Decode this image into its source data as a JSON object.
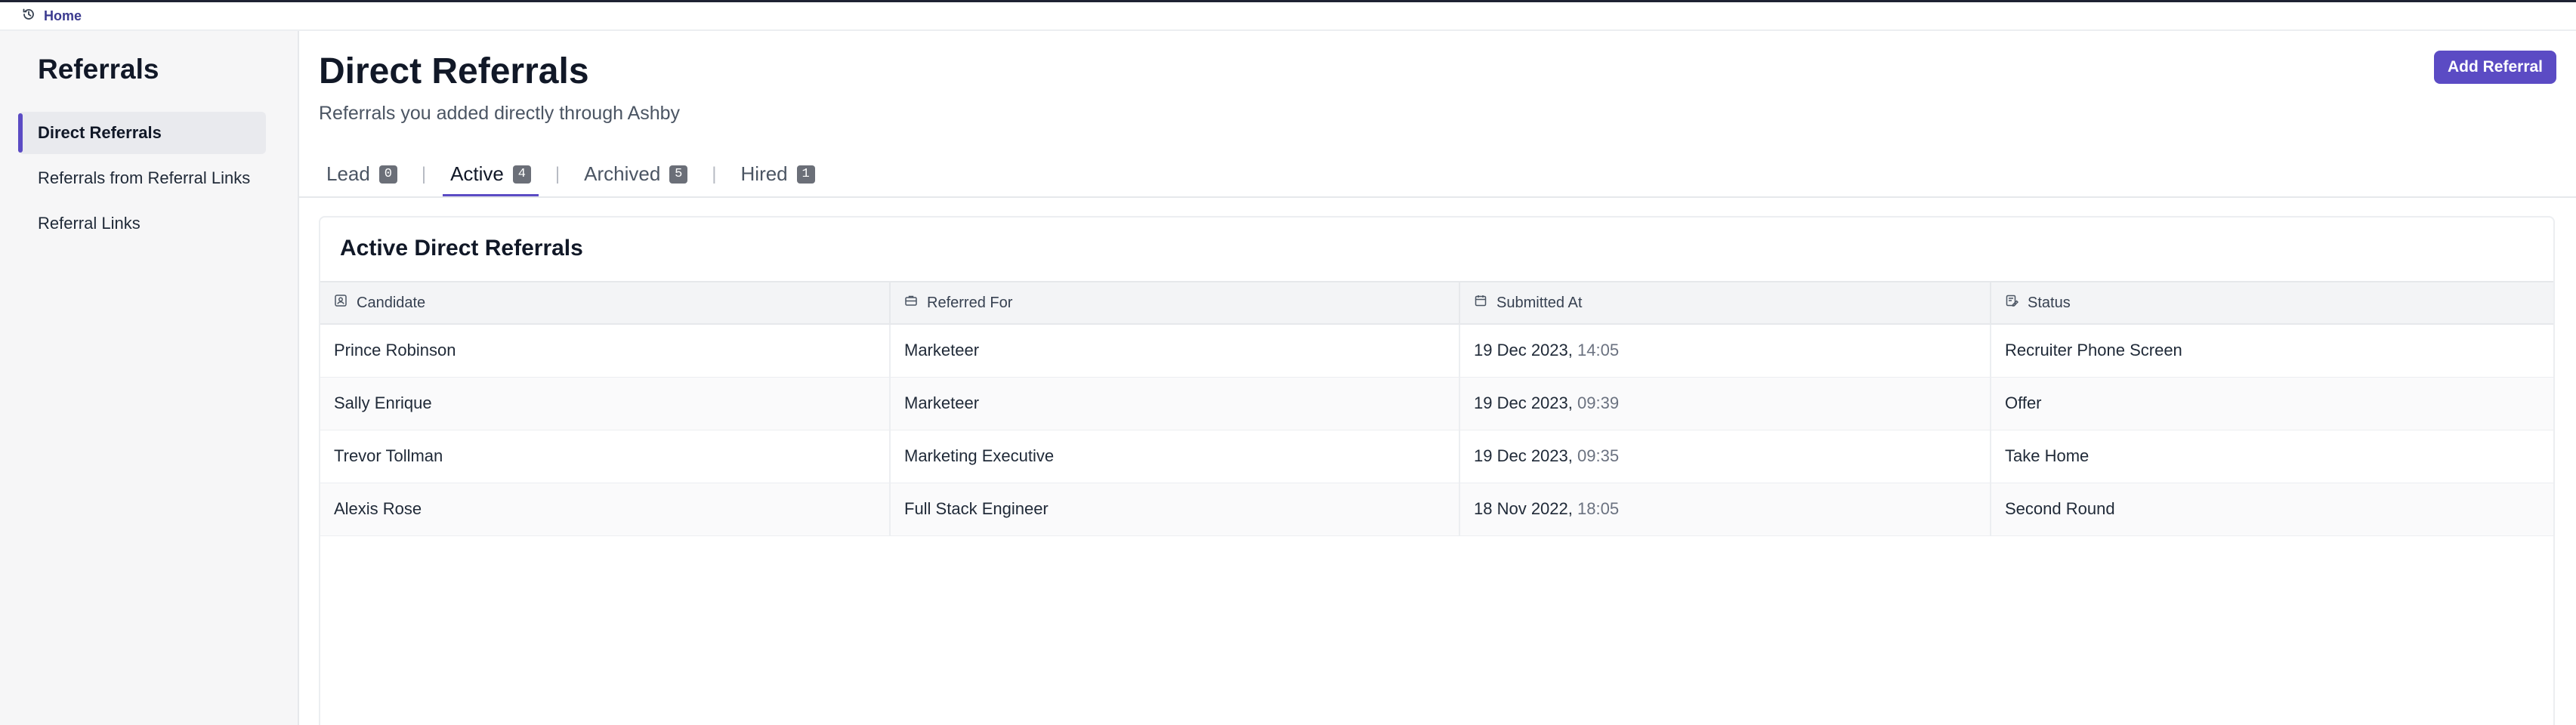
{
  "topbar": {
    "home_label": "Home"
  },
  "sidebar": {
    "title": "Referrals",
    "items": [
      {
        "label": "Direct Referrals",
        "active": true
      },
      {
        "label": "Referrals from Referral Links",
        "active": false
      },
      {
        "label": "Referral Links",
        "active": false
      }
    ]
  },
  "header": {
    "title": "Direct Referrals",
    "subtitle": "Referrals you added directly through Ashby",
    "add_button": "Add Referral"
  },
  "tabs": [
    {
      "label": "Lead",
      "count": "0",
      "active": false
    },
    {
      "label": "Active",
      "count": "4",
      "active": true
    },
    {
      "label": "Archived",
      "count": "5",
      "active": false
    },
    {
      "label": "Hired",
      "count": "1",
      "active": false
    }
  ],
  "table": {
    "title": "Active Direct Referrals",
    "columns": [
      {
        "label": "Candidate",
        "icon": "id-card-icon"
      },
      {
        "label": "Referred For",
        "icon": "briefcase-icon"
      },
      {
        "label": "Submitted At",
        "icon": "calendar-icon"
      },
      {
        "label": "Status",
        "icon": "status-edit-icon"
      }
    ],
    "rows": [
      {
        "candidate": "Prince Robinson",
        "referred_for": "Marketeer",
        "date": "19 Dec 2023,",
        "time": "14:05",
        "status": "Recruiter Phone Screen"
      },
      {
        "candidate": "Sally Enrique",
        "referred_for": "Marketeer",
        "date": "19 Dec 2023,",
        "time": "09:39",
        "status": "Offer"
      },
      {
        "candidate": "Trevor Tollman",
        "referred_for": "Marketing Executive",
        "date": "19 Dec 2023,",
        "time": "09:35",
        "status": "Take Home"
      },
      {
        "candidate": "Alexis Rose",
        "referred_for": "Full Stack Engineer",
        "date": "18 Nov 2022,",
        "time": "18:05",
        "status": "Second Round"
      }
    ]
  },
  "colors": {
    "accent": "#5b4bc4",
    "home_link": "#3b3a8f",
    "sidebar_bg": "#f6f6f7"
  }
}
